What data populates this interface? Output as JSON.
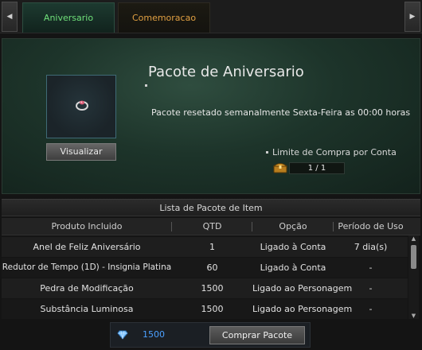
{
  "tabs": [
    {
      "label": "Aniversario",
      "active": true
    },
    {
      "label": "Comemoracao",
      "active": false
    }
  ],
  "nav": {
    "left_icon": "caret-left-icon",
    "right_icon": "caret-right-icon"
  },
  "package": {
    "title": "Pacote de Aniversario",
    "reset_note": "Pacote resetado semanalmente Sexta-Feira as 00:00 horas",
    "view_label": "Visualizar",
    "limit_label": "Limite de Compra por Conta",
    "limit_value": "1 / 1",
    "item_icon": "ring-icon",
    "limit_icon": "treasure-chest-icon"
  },
  "item_list": {
    "title": "Lista de Pacote de Item",
    "columns": [
      "Produto Incluido",
      "QTD",
      "Opção",
      "Período de Uso"
    ],
    "rows": [
      [
        "Anel de Feliz Aniversário",
        "1",
        "Ligado à Conta",
        "7 dia(s)"
      ],
      [
        "Redutor de Tempo (1D) - Insignia Platina",
        "60",
        "Ligado à Conta",
        "-"
      ],
      [
        "Pedra de Modificação",
        "1500",
        "Ligado ao Personagem",
        "-"
      ],
      [
        "Substância Luminosa",
        "1500",
        "Ligado ao Personagem",
        "-"
      ]
    ]
  },
  "footer": {
    "currency_icon": "diamond-icon",
    "price": "1500",
    "buy_label": "Comprar Pacote"
  },
  "colors": {
    "active_tab_text": "#6fe07a",
    "inactive_tab_text": "#e1a042",
    "price_text": "#4ba0ff"
  }
}
